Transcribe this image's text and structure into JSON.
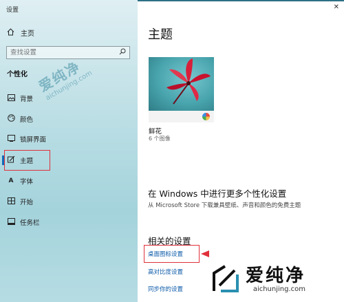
{
  "window": {
    "title": "设置"
  },
  "sidebar": {
    "home_label": "主页",
    "search_placeholder": "查找设置",
    "section_title": "个性化",
    "items": [
      {
        "label": "背景",
        "icon": "picture-icon"
      },
      {
        "label": "颜色",
        "icon": "palette-icon"
      },
      {
        "label": "锁屏界面",
        "icon": "lock-screen-icon"
      },
      {
        "label": "主题",
        "icon": "brush-icon",
        "selected": true
      },
      {
        "label": "字体",
        "icon": "font-icon"
      },
      {
        "label": "开始",
        "icon": "start-icon"
      },
      {
        "label": "任务栏",
        "icon": "taskbar-icon"
      }
    ]
  },
  "main": {
    "title": "主题",
    "theme": {
      "name": "鲜花",
      "count": "6 个图像"
    },
    "more_personalization": {
      "title": "在 Windows 中进行更多个性化设置",
      "description": "从 Microsoft Store 下载兼具壁纸、声音和颜色的免费主题"
    },
    "related": {
      "title": "相关的设置",
      "links": [
        "桌面图标设置",
        "高对比度设置",
        "同步你的设置"
      ]
    }
  },
  "watermark": {
    "cn": "爱纯净",
    "en": "aichunjing.com"
  },
  "colors": {
    "accent": "#0f6cbd",
    "highlight_box": "#e0303a",
    "link": "#0a5aa8"
  }
}
